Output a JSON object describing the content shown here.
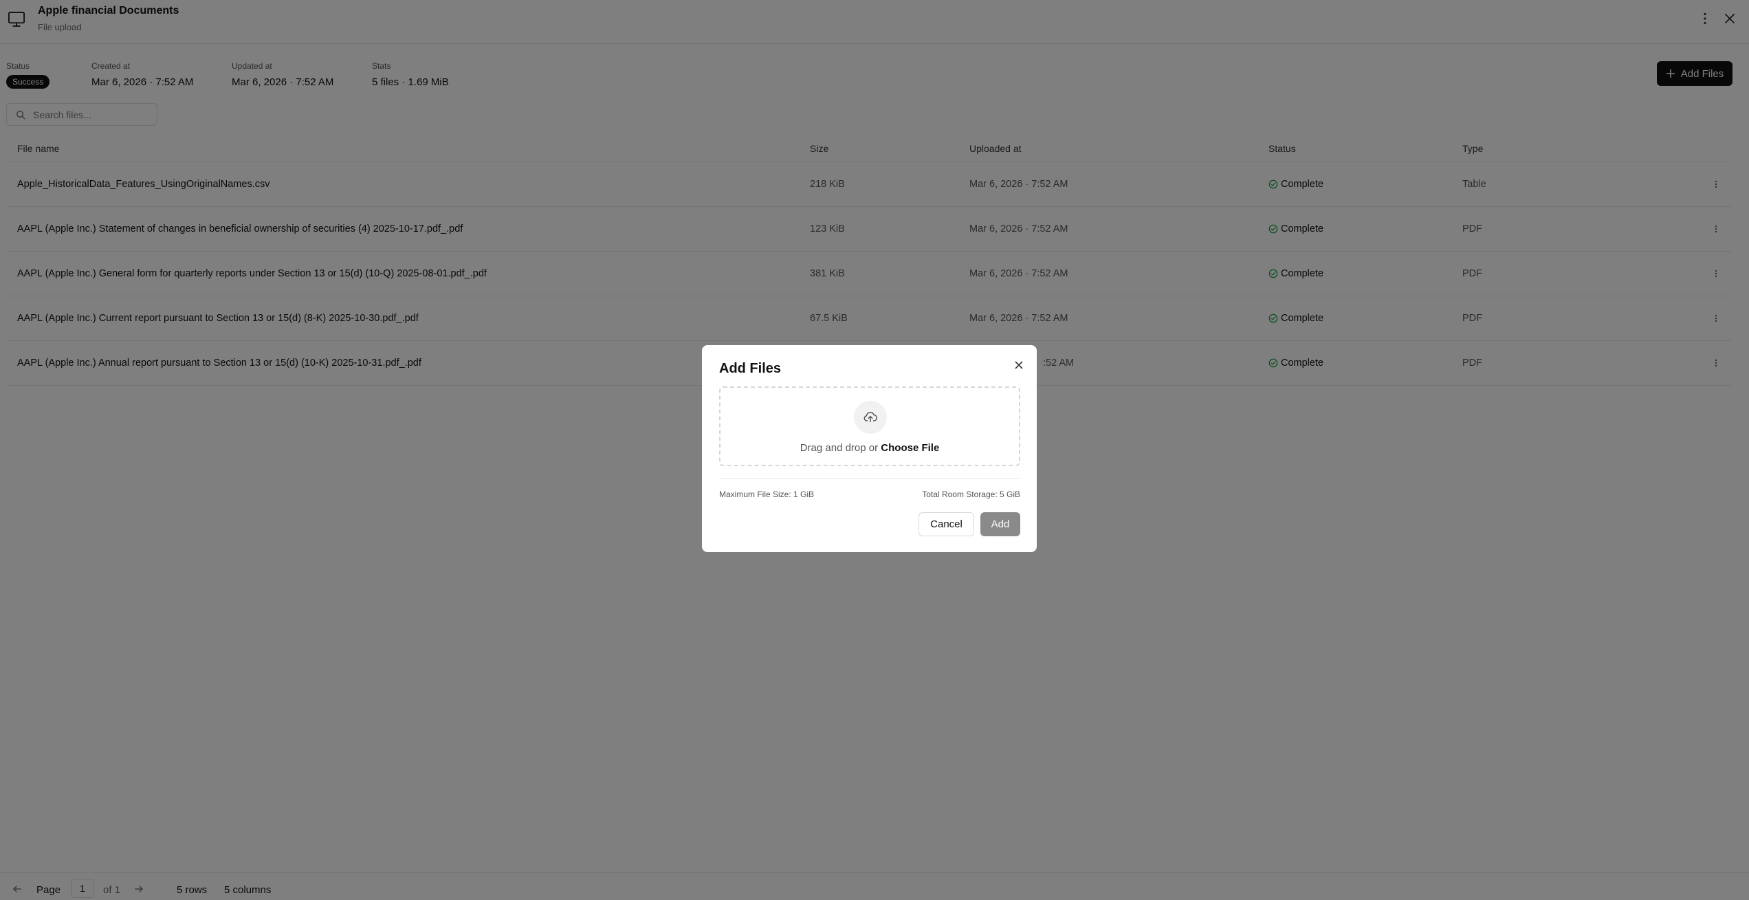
{
  "header": {
    "title": "Apple financial Documents",
    "subtitle": "File upload",
    "icon": "monitor-icon"
  },
  "meta": {
    "status_label": "Status",
    "status_value": "Success",
    "created_label": "Created at",
    "created_value": "Mar 6, 2026 · 7:52 AM",
    "updated_label": "Updated at",
    "updated_value": "Mar 6, 2026 · 7:52 AM",
    "stats_label": "Stats",
    "stats_value": "5 files · 1.69 MiB"
  },
  "toolbar": {
    "add_files_label": "Add Files"
  },
  "search": {
    "placeholder": "Search files..."
  },
  "table": {
    "columns": [
      "File name",
      "Size",
      "Uploaded at",
      "Status",
      "Type"
    ],
    "rows": [
      {
        "name": "Apple_HistoricalData_Features_UsingOriginalNames.csv",
        "size": "218 KiB",
        "uploaded": "Mar 6, 2026 · 7:52 AM",
        "status": "Complete",
        "type": "Table"
      },
      {
        "name": "AAPL (Apple Inc.) Statement of changes in beneficial ownership of securities (4) 2025-10-17.pdf_.pdf",
        "size": "123 KiB",
        "uploaded": "Mar 6, 2026 · 7:52 AM",
        "status": "Complete",
        "type": "PDF"
      },
      {
        "name": "AAPL (Apple Inc.) General form for quarterly reports under Section 13 or 15(d) (10-Q) 2025-08-01.pdf_.pdf",
        "size": "381 KiB",
        "uploaded": "Mar 6, 2026 · 7:52 AM",
        "status": "Complete",
        "type": "PDF"
      },
      {
        "name": "AAPL (Apple Inc.) Current report pursuant to Section 13 or 15(d) (8-K) 2025-10-30.pdf_.pdf",
        "size": "67.5 KiB",
        "uploaded": "Mar 6, 2026 · 7:52 AM",
        "status": "Complete",
        "type": "PDF"
      },
      {
        "name": "AAPL (Apple Inc.) Annual report pursuant to Section 13 or 15(d) (10-K) 2025-10-31.pdf_.pdf",
        "size": "",
        "uploaded": ":52 AM",
        "status": "Complete",
        "type": "PDF"
      }
    ]
  },
  "footer": {
    "page_label": "Page",
    "page_value": "1",
    "of_label": "of 1",
    "rows_label": "5 rows",
    "columns_label": "5 columns"
  },
  "modal": {
    "title": "Add Files",
    "drop_text": "Drag and drop or",
    "choose_file": "Choose File",
    "max_size": "Maximum File Size: 1 GiB",
    "total_storage": "Total Room Storage: 5 GiB",
    "cancel_label": "Cancel",
    "add_label": "Add"
  },
  "colors": {
    "success_green": "#22a34a",
    "primary_dark": "#111111",
    "disabled_button": "#8a8a8a",
    "overlay": "rgba(0,0,0,0.5)"
  }
}
